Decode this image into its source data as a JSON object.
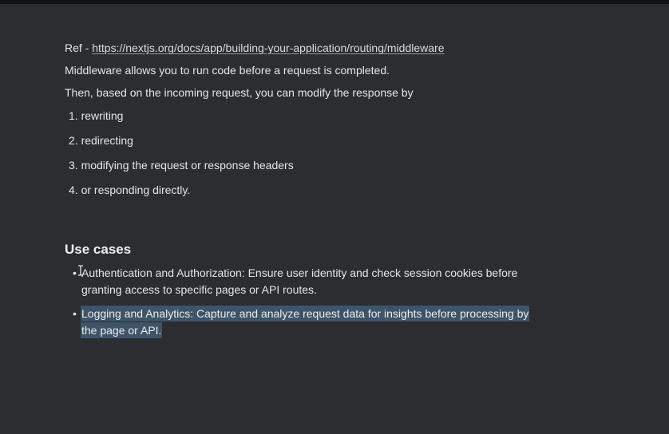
{
  "ref": {
    "prefix": "Ref - ",
    "link": "https://nextjs.org/docs/app/building-your-application/routing/middleware"
  },
  "intro": {
    "line1": "Middleware allows you to run code before a request is completed.",
    "line2": "Then, based on the incoming request, you can modify the response by"
  },
  "ordered_list": [
    "1. rewriting",
    "2. redirecting",
    "3. modifying the request or response headers",
    "4. or responding directly."
  ],
  "use_cases": {
    "heading": "Use cases",
    "items": [
      {
        "bullet": "•",
        "line1": "Authentication and Authorization: Ensure user identity and check session cookies before",
        "line2": "granting access to specific pages or API routes."
      },
      {
        "bullet": "•",
        "line1": "Logging and Analytics: Capture and analyze request data for insights before processing by",
        "line2": "the page or API.",
        "selected": true
      }
    ]
  },
  "colors": {
    "background": "#2b2d31",
    "text": "#e6e6e6",
    "selection": "#3e5468"
  }
}
